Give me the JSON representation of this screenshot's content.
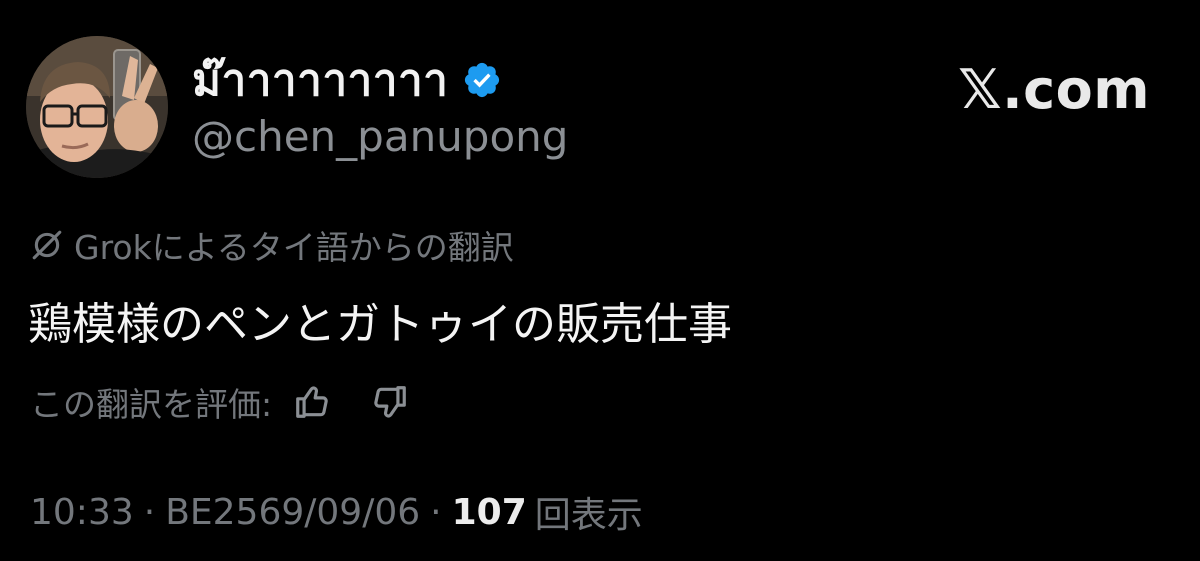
{
  "author": {
    "display_name": "ม๊าาาาาาาาา",
    "handle": "@chen_panupong",
    "verified_icon": "verified-badge-icon",
    "avatar_icon": "profile-photo"
  },
  "brand": {
    "label": "𝕏.com"
  },
  "translation": {
    "icon": "grok-icon",
    "notice": "Grokによるタイ語からの翻訳"
  },
  "tweet": {
    "text": "鶏模様のペンとガトゥイの販売仕事"
  },
  "rating": {
    "label": "この翻訳を評価:",
    "thumbs_up_icon": "thumbs-up-icon",
    "thumbs_down_icon": "thumbs-down-icon"
  },
  "meta": {
    "time": "10:33",
    "separator": "·",
    "date": "BE2569/09/06",
    "views_count": "107",
    "views_label": "回表示"
  },
  "colors": {
    "background": "#000000",
    "verified": "#1d9bf0",
    "muted": "#73777c",
    "handle": "#8b8f94",
    "text": "#f4f4f4"
  }
}
